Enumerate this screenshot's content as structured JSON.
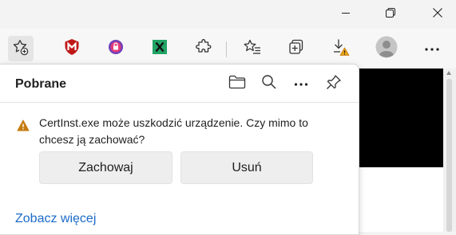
{
  "window_controls": {
    "minimize_icon": "minimize-icon",
    "restore_icon": "restore-icon",
    "close_icon": "close-icon"
  },
  "toolbar": {
    "icons": [
      "favorites-add-icon",
      "mcafee-icon",
      "privacy-extension-icon",
      "excel-extension-icon",
      "extensions-icon",
      "favorites-icon",
      "collections-icon",
      "downloads-warning-icon",
      "profile-avatar-icon",
      "settings-more-icon"
    ]
  },
  "colors": {
    "mcafee_red": "#c01818",
    "excel_green": "#21a366",
    "warning_amber": "#c67c12",
    "link_blue": "#1a6bc9"
  },
  "downloads": {
    "title": "Pobrane",
    "warning_text": "CertInst.exe może uszkodzić urządzenie. Czy mimo to chcesz ją zachować?",
    "keep_label": "Zachowaj",
    "delete_label": "Usuń",
    "see_more_label": "Zobacz więcej"
  }
}
